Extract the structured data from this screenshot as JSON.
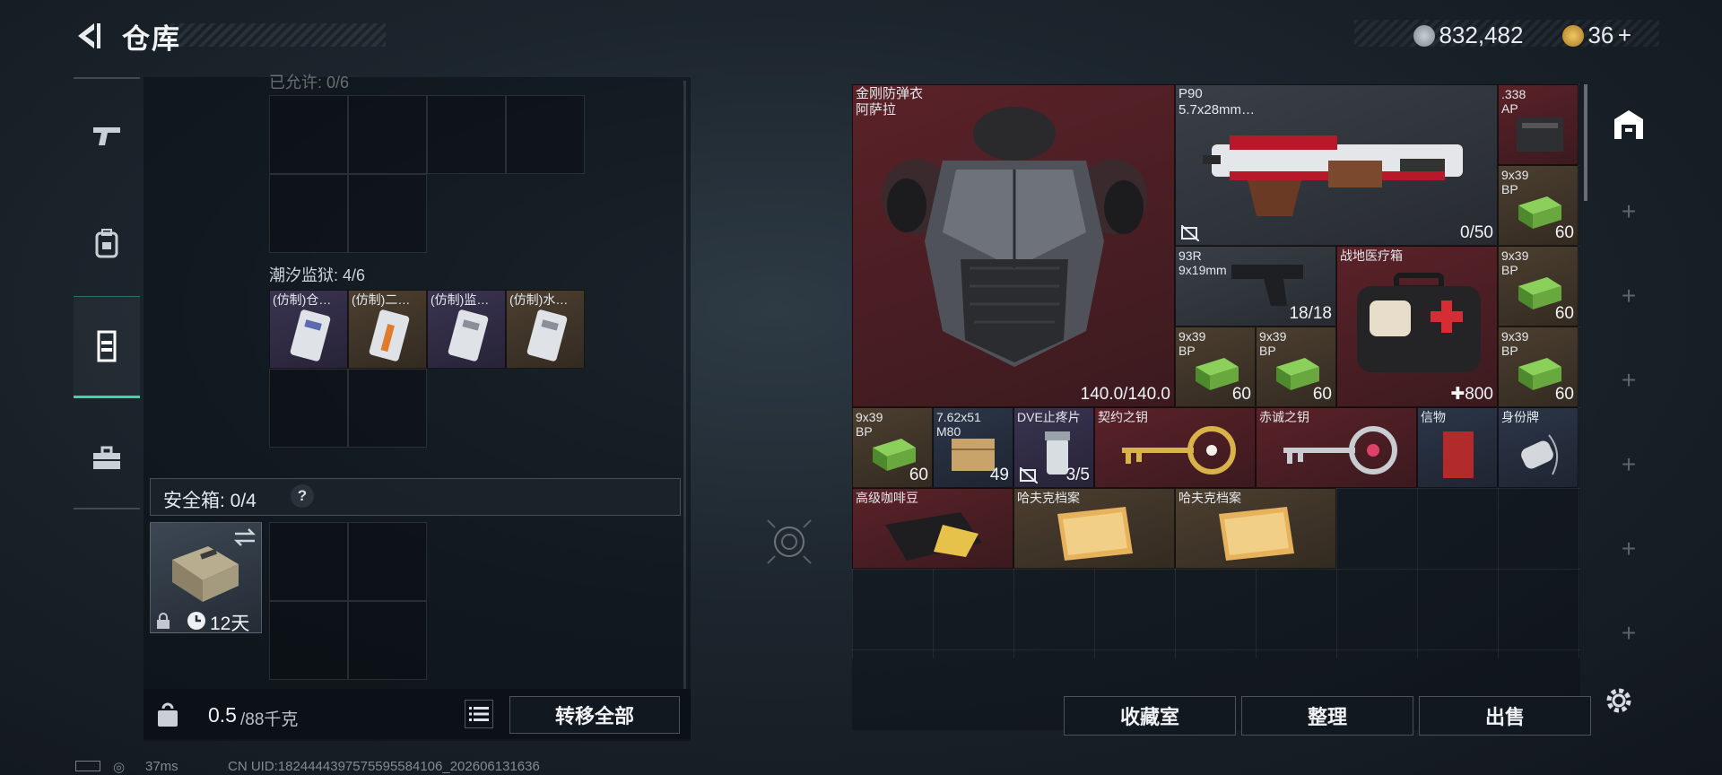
{
  "header": {
    "title": "仓库",
    "currency1": "832,482",
    "currency2": "36",
    "plus": "+"
  },
  "left": {
    "partial_label": "已允许: 0/6",
    "group_label": "潮汐监狱: 4/6",
    "items": [
      {
        "label": "(仿制)仓…"
      },
      {
        "label": "(仿制)二…"
      },
      {
        "label": "(仿制)监…"
      },
      {
        "label": "(仿制)水…"
      }
    ],
    "safe_label": "安全箱: 0/4",
    "safe_help": "?",
    "safe_timer": "12天",
    "weight_value": "0.5",
    "weight_max": "/88千克",
    "transfer_all": "转移全部"
  },
  "right": {
    "items": {
      "armor_name1": "金刚防弹衣",
      "armor_name2": "阿萨拉",
      "armor_count": "140.0/140.0",
      "p90_name": "P90",
      "p90_ammo": "5.7x28mm…",
      "p90_count": "0/50",
      "ap338_name": ".338",
      "ap338_sub": "AP",
      "ammo939_name": "9x39",
      "ammo939_sub": "BP",
      "sixty": "60",
      "pistol_name": "93R",
      "pistol_ammo": "9x19mm",
      "pistol_count": "18/18",
      "medkit_name": "战地医疗箱",
      "medkit_count": "800",
      "ammo762_name": "7.62x51",
      "ammo762_sub": "M80",
      "ammo762_count": "49",
      "dve_name": "DVE止疼片",
      "dve_count": "3/5",
      "key1_name": "契约之钥",
      "key2_name": "赤诚之钥",
      "letter_name": "信物",
      "tag_name": "身份牌",
      "coffee_name": "高级咖啡豆",
      "file1_name": "哈夫克档案",
      "file2_name": "哈夫克档案"
    },
    "buttons": {
      "collection": "收藏室",
      "organize": "整理",
      "sell": "出售"
    }
  },
  "status": {
    "ping": "37ms",
    "uid": "CN UID:1824444397575595584106_202606131636"
  },
  "colors": {
    "accent": "#3fd6a7",
    "red_rarity": "#5a2228",
    "gold_rarity": "#4c3f30"
  },
  "icons": [
    "back-icon",
    "pistol-tab-icon",
    "backpack-tab-icon",
    "vest-tab-icon",
    "toolbox-tab-icon",
    "lock-icon",
    "list-icon",
    "gear-icon",
    "container-icon",
    "swap-icon",
    "clock-icon"
  ]
}
